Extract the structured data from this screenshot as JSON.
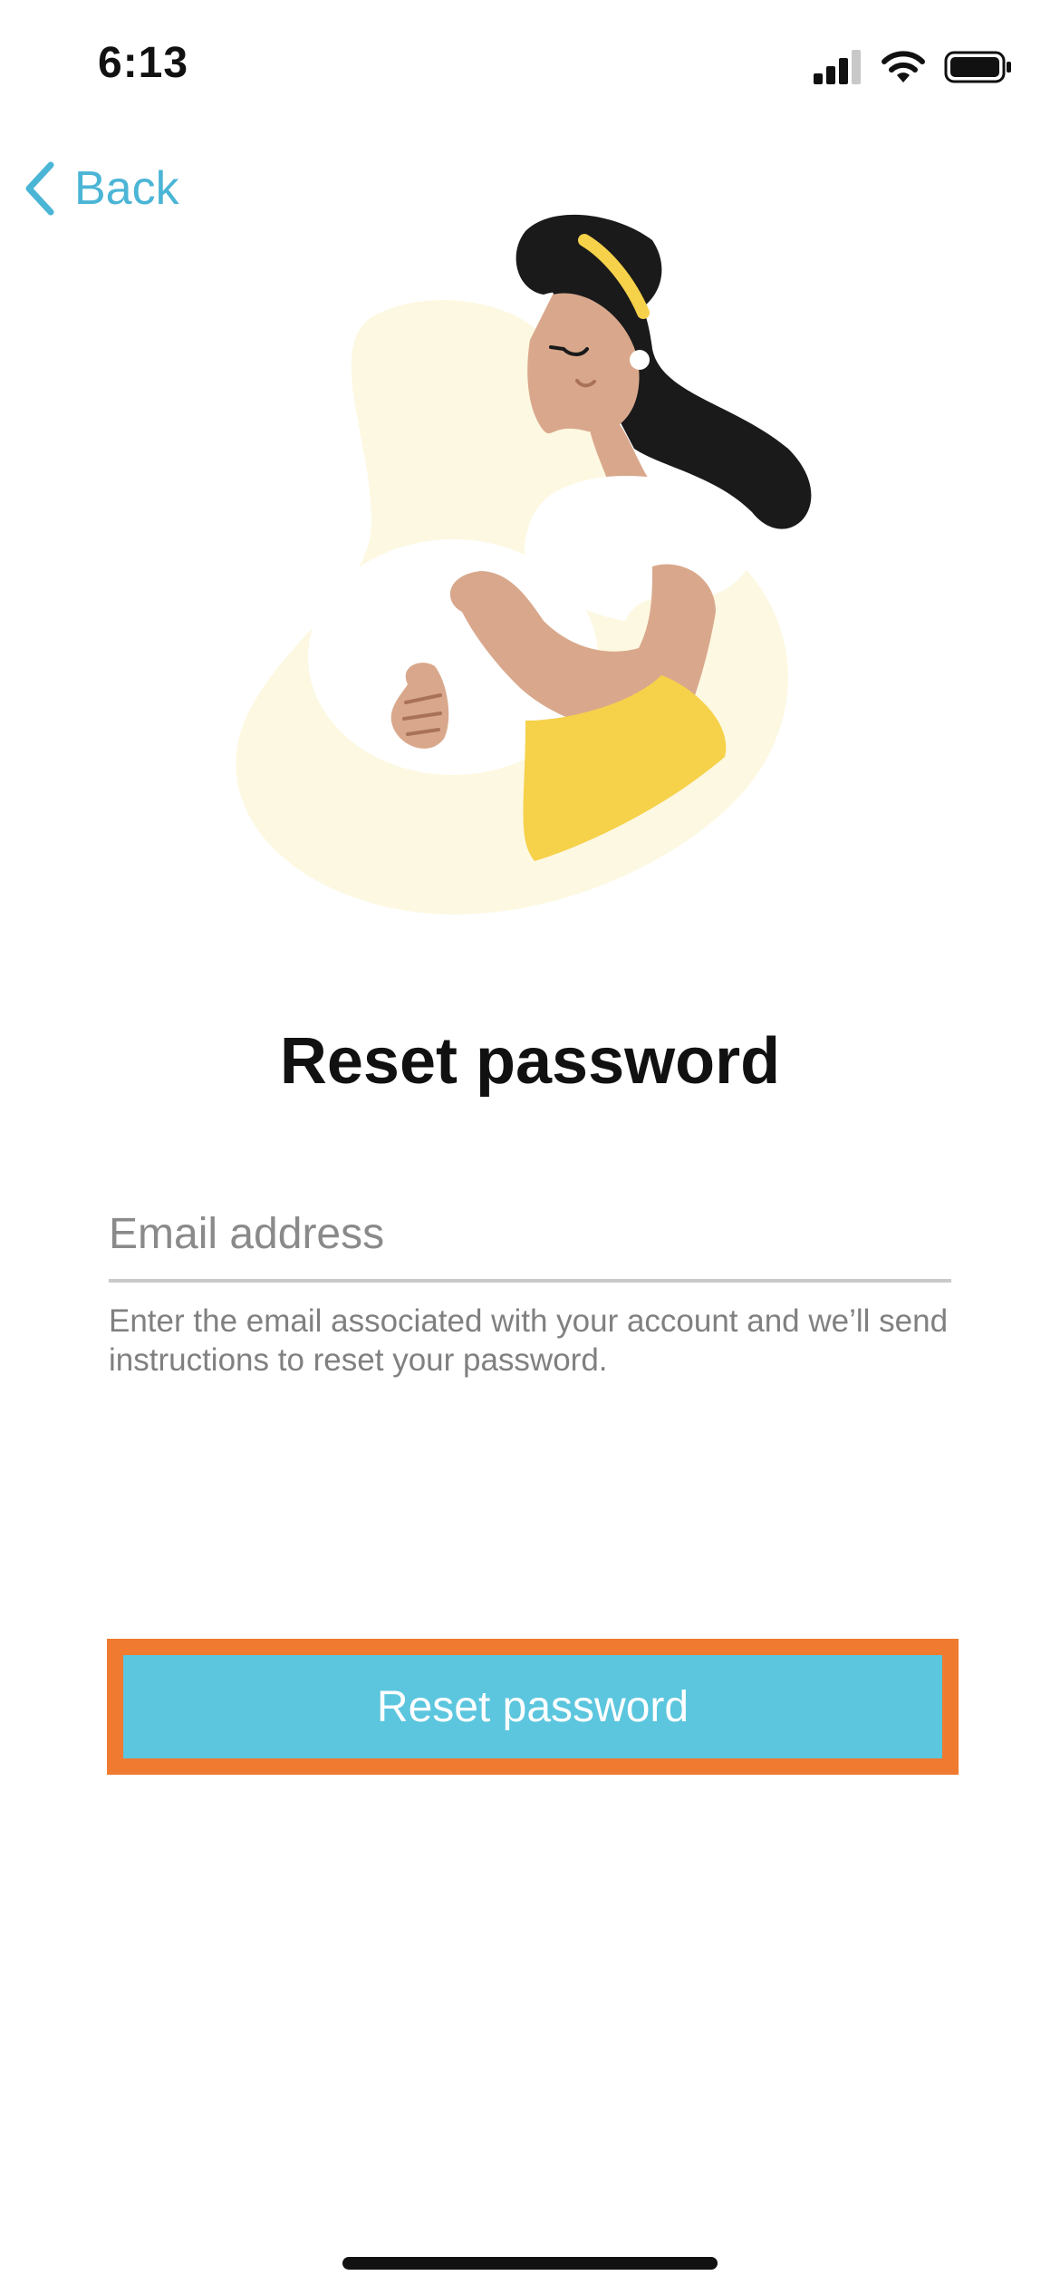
{
  "status_bar": {
    "time": "6:13",
    "signal_icon": "signal-bars-icon",
    "wifi_icon": "wifi-icon",
    "battery_icon": "battery-full-icon"
  },
  "nav": {
    "back_label": "Back",
    "back_icon": "chevron-left-icon"
  },
  "illustration": {
    "subject": "pregnant-woman-illustration",
    "colors": {
      "blob": "#fdf8e1",
      "hair": "#1a1a1a",
      "skin": "#d9a88c",
      "shirt": "#ffffff",
      "skirt": "#f6d14a",
      "headband": "#f6d14a"
    }
  },
  "title": "Reset password",
  "form": {
    "email_placeholder": "Email address",
    "email_value": "",
    "helper_text": "Enter the email associated with your account and we’ll send instructions to reset your password."
  },
  "actions": {
    "reset_label": "Reset password"
  },
  "colors": {
    "accent": "#4bb5d6",
    "button": "#5bc6de",
    "highlight": "#ef7a30"
  }
}
